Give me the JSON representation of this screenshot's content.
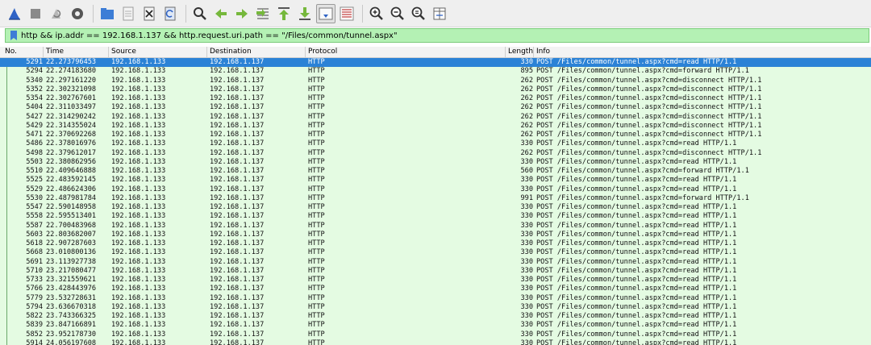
{
  "toolbar": {
    "buttons": [
      {
        "name": "start-capture-icon"
      },
      {
        "name": "stop-capture-icon"
      },
      {
        "name": "restart-capture-icon"
      },
      {
        "name": "capture-options-icon"
      },
      {
        "name": "open-file-icon"
      },
      {
        "name": "save-file-icon"
      },
      {
        "name": "close-file-icon"
      },
      {
        "name": "reload-file-icon"
      },
      {
        "name": "find-packet-icon"
      },
      {
        "name": "go-back-icon"
      },
      {
        "name": "go-forward-icon"
      },
      {
        "name": "go-to-packet-icon"
      },
      {
        "name": "go-first-packet-icon"
      },
      {
        "name": "go-last-packet-icon"
      },
      {
        "name": "autoscroll-icon"
      },
      {
        "name": "colorize-icon"
      },
      {
        "name": "zoom-in-icon"
      },
      {
        "name": "zoom-out-icon"
      },
      {
        "name": "zoom-normal-icon"
      },
      {
        "name": "resize-columns-icon"
      }
    ]
  },
  "filter": {
    "value": "http && ip.addr == 192.168.1.137 && http.request.uri.path == \"/Files/common/tunnel.aspx\""
  },
  "columns": {
    "no": "No.",
    "time": "Time",
    "source": "Source",
    "destination": "Destination",
    "protocol": "Protocol",
    "length": "Length",
    "info": "Info"
  },
  "colors": {
    "row_bg": "#e4fbe2",
    "selected_bg": "#2b82d6",
    "filter_bg": "#b4f1b4"
  },
  "packets": [
    {
      "no": "5291",
      "time": "22.273796453",
      "source": "192.168.1.133",
      "destination": "192.168.1.137",
      "protocol": "HTTP",
      "length": "330",
      "info": "POST /Files/common/tunnel.aspx?cmd=read HTTP/1.1",
      "selected": true
    },
    {
      "no": "5294",
      "time": "22.274183680",
      "source": "192.168.1.133",
      "destination": "192.168.1.137",
      "protocol": "HTTP",
      "length": "895",
      "info": "POST /Files/common/tunnel.aspx?cmd=forward HTTP/1.1"
    },
    {
      "no": "5340",
      "time": "22.297161220",
      "source": "192.168.1.133",
      "destination": "192.168.1.137",
      "protocol": "HTTP",
      "length": "262",
      "info": "POST /Files/common/tunnel.aspx?cmd=disconnect HTTP/1.1"
    },
    {
      "no": "5352",
      "time": "22.302321098",
      "source": "192.168.1.133",
      "destination": "192.168.1.137",
      "protocol": "HTTP",
      "length": "262",
      "info": "POST /Files/common/tunnel.aspx?cmd=disconnect HTTP/1.1"
    },
    {
      "no": "5354",
      "time": "22.302767601",
      "source": "192.168.1.133",
      "destination": "192.168.1.137",
      "protocol": "HTTP",
      "length": "262",
      "info": "POST /Files/common/tunnel.aspx?cmd=disconnect HTTP/1.1"
    },
    {
      "no": "5404",
      "time": "22.311033497",
      "source": "192.168.1.133",
      "destination": "192.168.1.137",
      "protocol": "HTTP",
      "length": "262",
      "info": "POST /Files/common/tunnel.aspx?cmd=disconnect HTTP/1.1"
    },
    {
      "no": "5427",
      "time": "22.314290242",
      "source": "192.168.1.133",
      "destination": "192.168.1.137",
      "protocol": "HTTP",
      "length": "262",
      "info": "POST /Files/common/tunnel.aspx?cmd=disconnect HTTP/1.1"
    },
    {
      "no": "5429",
      "time": "22.314355024",
      "source": "192.168.1.133",
      "destination": "192.168.1.137",
      "protocol": "HTTP",
      "length": "262",
      "info": "POST /Files/common/tunnel.aspx?cmd=disconnect HTTP/1.1"
    },
    {
      "no": "5471",
      "time": "22.370692268",
      "source": "192.168.1.133",
      "destination": "192.168.1.137",
      "protocol": "HTTP",
      "length": "262",
      "info": "POST /Files/common/tunnel.aspx?cmd=disconnect HTTP/1.1"
    },
    {
      "no": "5486",
      "time": "22.378016976",
      "source": "192.168.1.133",
      "destination": "192.168.1.137",
      "protocol": "HTTP",
      "length": "330",
      "info": "POST /Files/common/tunnel.aspx?cmd=read HTTP/1.1"
    },
    {
      "no": "5498",
      "time": "22.379612017",
      "source": "192.168.1.133",
      "destination": "192.168.1.137",
      "protocol": "HTTP",
      "length": "262",
      "info": "POST /Files/common/tunnel.aspx?cmd=disconnect HTTP/1.1"
    },
    {
      "no": "5503",
      "time": "22.380862956",
      "source": "192.168.1.133",
      "destination": "192.168.1.137",
      "protocol": "HTTP",
      "length": "330",
      "info": "POST /Files/common/tunnel.aspx?cmd=read HTTP/1.1"
    },
    {
      "no": "5510",
      "time": "22.409646888",
      "source": "192.168.1.133",
      "destination": "192.168.1.137",
      "protocol": "HTTP",
      "length": "560",
      "info": "POST /Files/common/tunnel.aspx?cmd=forward HTTP/1.1"
    },
    {
      "no": "5525",
      "time": "22.483592145",
      "source": "192.168.1.133",
      "destination": "192.168.1.137",
      "protocol": "HTTP",
      "length": "330",
      "info": "POST /Files/common/tunnel.aspx?cmd=read HTTP/1.1"
    },
    {
      "no": "5529",
      "time": "22.486624306",
      "source": "192.168.1.133",
      "destination": "192.168.1.137",
      "protocol": "HTTP",
      "length": "330",
      "info": "POST /Files/common/tunnel.aspx?cmd=read HTTP/1.1"
    },
    {
      "no": "5530",
      "time": "22.487981784",
      "source": "192.168.1.133",
      "destination": "192.168.1.137",
      "protocol": "HTTP",
      "length": "991",
      "info": "POST /Files/common/tunnel.aspx?cmd=forward HTTP/1.1"
    },
    {
      "no": "5547",
      "time": "22.590148958",
      "source": "192.168.1.133",
      "destination": "192.168.1.137",
      "protocol": "HTTP",
      "length": "330",
      "info": "POST /Files/common/tunnel.aspx?cmd=read HTTP/1.1"
    },
    {
      "no": "5558",
      "time": "22.595513401",
      "source": "192.168.1.133",
      "destination": "192.168.1.137",
      "protocol": "HTTP",
      "length": "330",
      "info": "POST /Files/common/tunnel.aspx?cmd=read HTTP/1.1"
    },
    {
      "no": "5587",
      "time": "22.700483968",
      "source": "192.168.1.133",
      "destination": "192.168.1.137",
      "protocol": "HTTP",
      "length": "330",
      "info": "POST /Files/common/tunnel.aspx?cmd=read HTTP/1.1"
    },
    {
      "no": "5603",
      "time": "22.803682007",
      "source": "192.168.1.133",
      "destination": "192.168.1.137",
      "protocol": "HTTP",
      "length": "330",
      "info": "POST /Files/common/tunnel.aspx?cmd=read HTTP/1.1"
    },
    {
      "no": "5618",
      "time": "22.907287603",
      "source": "192.168.1.133",
      "destination": "192.168.1.137",
      "protocol": "HTTP",
      "length": "330",
      "info": "POST /Files/common/tunnel.aspx?cmd=read HTTP/1.1"
    },
    {
      "no": "5668",
      "time": "23.010800136",
      "source": "192.168.1.133",
      "destination": "192.168.1.137",
      "protocol": "HTTP",
      "length": "330",
      "info": "POST /Files/common/tunnel.aspx?cmd=read HTTP/1.1"
    },
    {
      "no": "5691",
      "time": "23.113927738",
      "source": "192.168.1.133",
      "destination": "192.168.1.137",
      "protocol": "HTTP",
      "length": "330",
      "info": "POST /Files/common/tunnel.aspx?cmd=read HTTP/1.1"
    },
    {
      "no": "5710",
      "time": "23.217080477",
      "source": "192.168.1.133",
      "destination": "192.168.1.137",
      "protocol": "HTTP",
      "length": "330",
      "info": "POST /Files/common/tunnel.aspx?cmd=read HTTP/1.1"
    },
    {
      "no": "5733",
      "time": "23.321559621",
      "source": "192.168.1.133",
      "destination": "192.168.1.137",
      "protocol": "HTTP",
      "length": "330",
      "info": "POST /Files/common/tunnel.aspx?cmd=read HTTP/1.1"
    },
    {
      "no": "5766",
      "time": "23.428443976",
      "source": "192.168.1.133",
      "destination": "192.168.1.137",
      "protocol": "HTTP",
      "length": "330",
      "info": "POST /Files/common/tunnel.aspx?cmd=read HTTP/1.1"
    },
    {
      "no": "5779",
      "time": "23.532728631",
      "source": "192.168.1.133",
      "destination": "192.168.1.137",
      "protocol": "HTTP",
      "length": "330",
      "info": "POST /Files/common/tunnel.aspx?cmd=read HTTP/1.1"
    },
    {
      "no": "5794",
      "time": "23.636670318",
      "source": "192.168.1.133",
      "destination": "192.168.1.137",
      "protocol": "HTTP",
      "length": "330",
      "info": "POST /Files/common/tunnel.aspx?cmd=read HTTP/1.1"
    },
    {
      "no": "5822",
      "time": "23.743366325",
      "source": "192.168.1.133",
      "destination": "192.168.1.137",
      "protocol": "HTTP",
      "length": "330",
      "info": "POST /Files/common/tunnel.aspx?cmd=read HTTP/1.1"
    },
    {
      "no": "5839",
      "time": "23.847166891",
      "source": "192.168.1.133",
      "destination": "192.168.1.137",
      "protocol": "HTTP",
      "length": "330",
      "info": "POST /Files/common/tunnel.aspx?cmd=read HTTP/1.1"
    },
    {
      "no": "5852",
      "time": "23.952178730",
      "source": "192.168.1.133",
      "destination": "192.168.1.137",
      "protocol": "HTTP",
      "length": "330",
      "info": "POST /Files/common/tunnel.aspx?cmd=read HTTP/1.1"
    },
    {
      "no": "5914",
      "time": "24.056197608",
      "source": "192.168.1.133",
      "destination": "192.168.1.137",
      "protocol": "HTTP",
      "length": "330",
      "info": "POST /Files/common/tunnel.aspx?cmd=read HTTP/1.1"
    }
  ]
}
